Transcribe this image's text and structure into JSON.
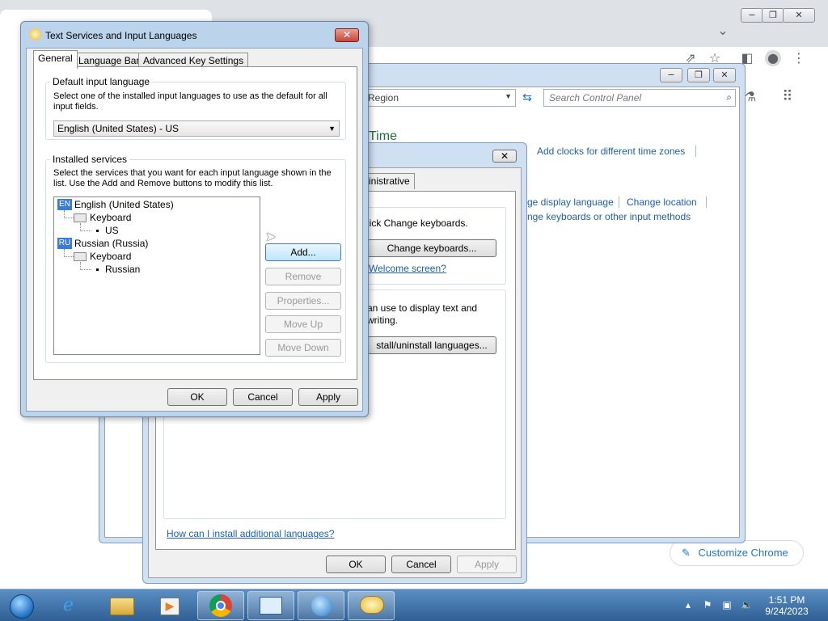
{
  "chrome": {
    "minimize": "−",
    "restore": "❐",
    "close": "✕",
    "customize_label": "Customize Chrome"
  },
  "control_panel": {
    "address_text": "Region",
    "search_placeholder": "Search Control Panel",
    "heading": "Time",
    "links": {
      "add_clocks": "Add clocks for different time zones",
      "change_display_language": "ge display language",
      "change_location": "Change location",
      "change_keyboards": "nge keyboards or other input methods"
    }
  },
  "region_dialog": {
    "tab_admin": "inistrative",
    "keyboards_text": "lick Change keyboards.",
    "change_keyboards_button": "Change keyboards...",
    "welcome_link": "Welcome screen?",
    "display_text_line1": "an use to display text and",
    "display_text_line2": "writing.",
    "install_button": "stall/uninstall languages...",
    "how_install_link": "How can I install additional languages?",
    "ok": "OK",
    "cancel": "Cancel",
    "apply": "Apply"
  },
  "text_services": {
    "title": "Text Services and Input Languages",
    "tabs": [
      "General",
      "Language Bar",
      "Advanced Key Settings"
    ],
    "default_group_label": "Default input language",
    "default_desc": "Select one of the installed input languages to use as the default for all input fields.",
    "default_value": "English (United States) - US",
    "installed_group_label": "Installed services",
    "installed_desc": "Select the services that you want for each input language shown in the list. Use the Add and Remove buttons to modify this list.",
    "tree": [
      {
        "badge": "EN",
        "language": "English (United States)",
        "service": "Keyboard",
        "layout": "US"
      },
      {
        "badge": "RU",
        "language": "Russian (Russia)",
        "service": "Keyboard",
        "layout": "Russian"
      }
    ],
    "buttons": {
      "add": "Add...",
      "remove": "Remove",
      "properties": "Properties...",
      "move_up": "Move Up",
      "move_down": "Move Down",
      "ok": "OK",
      "cancel": "Cancel",
      "apply": "Apply"
    }
  },
  "taskbar": {
    "time": "1:51 PM",
    "date": "9/24/2023"
  }
}
